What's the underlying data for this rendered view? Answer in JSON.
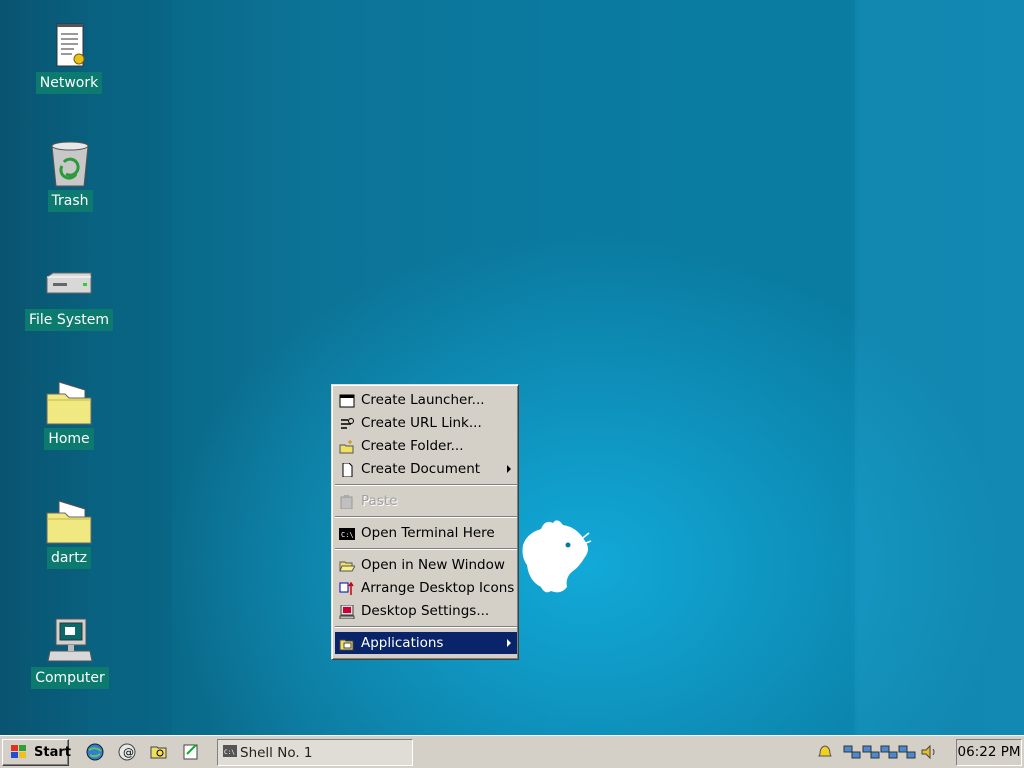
{
  "desktop": {
    "icons": [
      {
        "label": "Network",
        "icon": "network-document-icon"
      },
      {
        "label": "Trash",
        "icon": "trash-icon"
      },
      {
        "label": "File System",
        "icon": "drive-icon"
      },
      {
        "label": "Home",
        "icon": "folder-icon"
      },
      {
        "label": "dartz",
        "icon": "folder-icon"
      },
      {
        "label": "Computer",
        "icon": "computer-icon"
      }
    ]
  },
  "context_menu": {
    "items": [
      {
        "label": "Create Launcher...",
        "icon": "launcher-icon"
      },
      {
        "label": "Create URL Link...",
        "icon": "url-link-icon"
      },
      {
        "label": "Create Folder...",
        "icon": "new-folder-icon"
      },
      {
        "label": "Create Document",
        "icon": "document-icon",
        "submenu": true
      },
      {
        "label": "Paste",
        "icon": "paste-icon",
        "disabled": true
      },
      {
        "label": "Open Terminal Here",
        "icon": "terminal-icon"
      },
      {
        "label": "Open in New Window",
        "icon": "open-folder-icon"
      },
      {
        "label": "Arrange Desktop Icons",
        "icon": "arrange-icon"
      },
      {
        "label": "Desktop Settings...",
        "icon": "desktop-settings-icon"
      },
      {
        "label": "Applications",
        "icon": "applications-icon",
        "submenu": true,
        "selected": true
      }
    ]
  },
  "taskbar": {
    "start_label": "Start",
    "quick_launch": [
      "browser-icon",
      "mail-icon",
      "file-manager-icon",
      "editor-icon"
    ],
    "tasks": [
      {
        "label": "Shell No. 1",
        "icon": "terminal-icon"
      }
    ],
    "tray": [
      "notification-bell-icon",
      "network-activity-icon",
      "network-activity-icon",
      "network-activity-icon",
      "network-activity-icon",
      "volume-icon"
    ],
    "clock": "06:22 PM"
  },
  "colors": {
    "desktop": "#0b78a0",
    "selection": "#0a246a",
    "chrome": "#d4d0c8",
    "icon_label_bg": "#0d7a70"
  }
}
